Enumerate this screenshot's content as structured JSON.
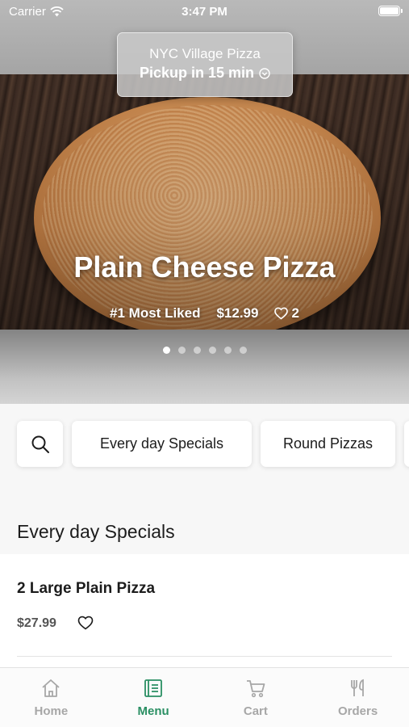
{
  "status_bar": {
    "carrier": "Carrier",
    "time": "3:47 PM"
  },
  "store": {
    "name": "NYC Village Pizza",
    "pickup": "Pickup in 15 min"
  },
  "featured": {
    "title": "Plain Cheese Pizza",
    "badge": "#1 Most Liked",
    "price": "$12.99",
    "likes": "2",
    "carousel_total": 6,
    "carousel_active": 1
  },
  "categories": {
    "items": [
      "Every day Specials",
      "Round Pizzas"
    ]
  },
  "section": {
    "title": "Every day Specials"
  },
  "products": [
    {
      "name": "2 Large Plain Pizza",
      "price": "$27.99"
    }
  ],
  "tabs": [
    {
      "label": "Home",
      "icon": "home-icon",
      "active": false
    },
    {
      "label": "Menu",
      "icon": "menu-icon",
      "active": true
    },
    {
      "label": "Cart",
      "icon": "cart-icon",
      "active": false
    },
    {
      "label": "Orders",
      "icon": "fork-knife-icon",
      "active": false
    }
  ],
  "colors": {
    "accent": "#2a8f63",
    "inactive": "#a7a7a7"
  }
}
